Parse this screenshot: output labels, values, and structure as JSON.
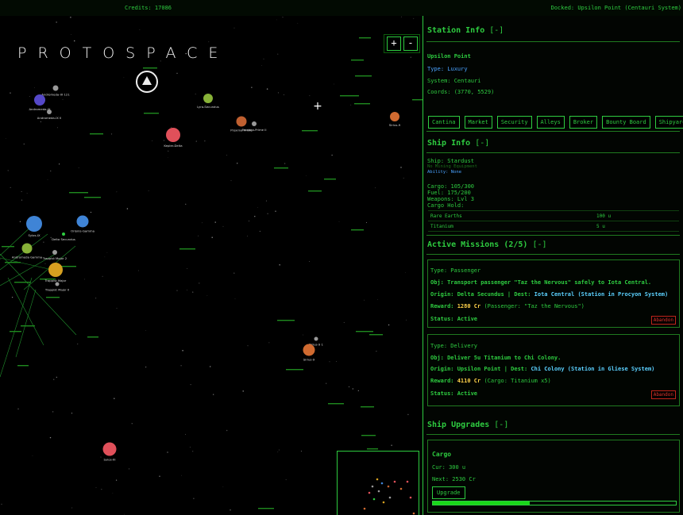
{
  "topbar": {
    "credits": "Credits: 17086",
    "docked": "Docked: Upsilon Point (Centauri System)"
  },
  "map": {
    "logo": "PROTOSPACE",
    "zoom_in": "+",
    "zoom_out": "-",
    "cursor": "+",
    "planets": [
      {
        "name": "Andromeda-IX 121",
        "color": "#999999"
      },
      {
        "name": "Andromeda-IX",
        "color": "#5548c8"
      },
      {
        "name": "Andromeda-IX II",
        "color": "#999999"
      },
      {
        "name": "Lyra-Secundus",
        "color": "#88b238"
      },
      {
        "name": "Kepler-Delta",
        "color": "#e0505a"
      },
      {
        "name": "Proxima-Prime",
        "color": "#c06030"
      },
      {
        "name": "Proxima-Prime II",
        "color": "#999999"
      },
      {
        "name": "Sirius-9",
        "color": "#d06a30"
      },
      {
        "name": "Sylos-IX",
        "color": "#3f84d6"
      },
      {
        "name": "Orionis-Gamma",
        "color": "#3f84d6"
      },
      {
        "name": "Delta Secundus",
        "color": "#2ecc40"
      },
      {
        "name": "Andromeda Gamma",
        "color": "#88b238"
      },
      {
        "name": "Trappist Major 2",
        "color": "#999999"
      },
      {
        "name": "Trappist Major",
        "color": "#d6a020"
      },
      {
        "name": "Trappist Major II",
        "color": "#999999"
      },
      {
        "name": "Sirius-9 1",
        "color": "#999999"
      },
      {
        "name": "Sirius-9",
        "color": "#d06a30"
      },
      {
        "name": "Sylos-XI",
        "color": "#e0505a"
      }
    ]
  },
  "station": {
    "title": "Station Info",
    "toggle": "[-]",
    "name": "Upsilon Point",
    "type": "Type: Luxury",
    "system": "System: Centauri",
    "coords": "Coords: (3770, 5529)",
    "buttons": [
      "Cantina",
      "Market",
      "Security",
      "Alleys",
      "Broker",
      "Bounty Board",
      "Shipyard"
    ]
  },
  "ship": {
    "title": "Ship Info",
    "toggle": "[-]",
    "name": "Ship: Stardust",
    "equipment": "No Mining Equipment",
    "ability": "Ability: None",
    "cargo": "Cargo: 105/300",
    "fuel": "Fuel: 175/200",
    "weapons": "Weapons: Lvl 3",
    "hold_label": "Cargo Hold:",
    "hold": [
      {
        "item": "Rare Earths",
        "qty": "100 u"
      },
      {
        "item": "Titanium",
        "qty": "5 u"
      }
    ]
  },
  "missions": {
    "title": "Active Missions (2/5)",
    "toggle": "[-]",
    "list": [
      {
        "type": "Type: Passenger",
        "obj": "Obj: Transport passenger \"Taz the Nervous\" safely to Iota Central.",
        "origin": "Origin: Delta Secundus | Dest: ",
        "dest": "Iota Central (Station in Procyon System)",
        "reward_label": "Reward: ",
        "reward": "1280 Cr",
        "reward_note": " (Passenger: \"Taz the Nervous\")",
        "status": "Status: Active",
        "abandon": "Abandon"
      },
      {
        "type": "Type: Delivery",
        "obj": "Obj: Deliver 5u Titanium to Chi Colony.",
        "origin": "Origin: Upsilon Point | Dest: ",
        "dest": "Chi Colony (Station in Gliese System)",
        "reward_label": "Reward: ",
        "reward": "4110 Cr",
        "reward_note": " (Cargo: Titanium x5)",
        "status": "Status: Active",
        "abandon": "Abandon"
      }
    ]
  },
  "upgrades": {
    "title": "Ship Upgrades",
    "toggle": "[-]",
    "item": "Cargo",
    "cur": "Cur: 300 u",
    "next": "Next: 2530 Cr",
    "button": "Upgrade",
    "progress": 0.4
  }
}
